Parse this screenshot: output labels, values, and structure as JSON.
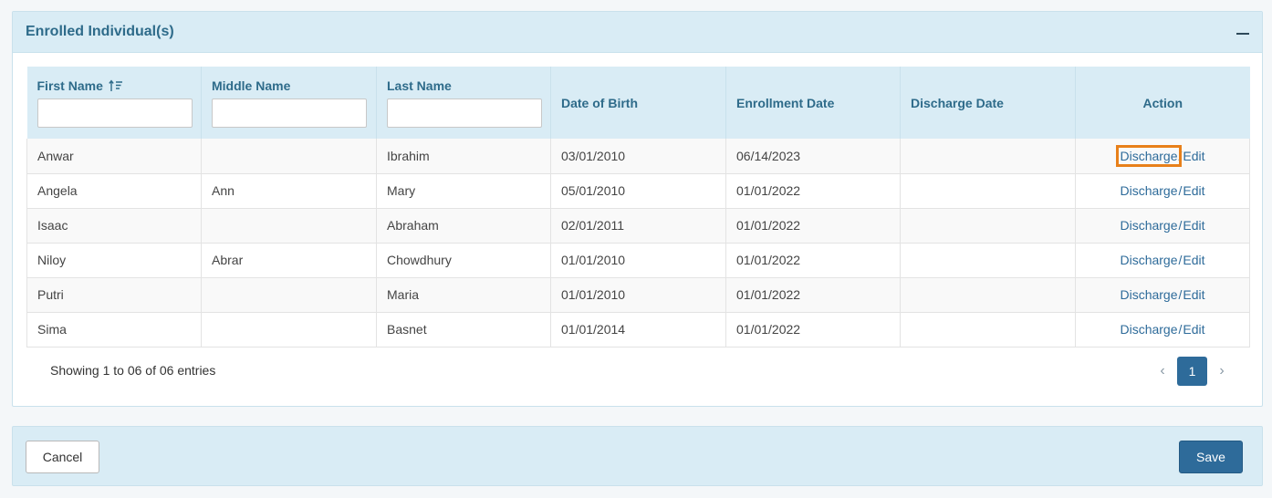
{
  "panel": {
    "title": "Enrolled Individual(s)"
  },
  "table": {
    "headers": {
      "first_name": "First Name",
      "middle_name": "Middle Name",
      "last_name": "Last Name",
      "dob": "Date of Birth",
      "enrollment_date": "Enrollment Date",
      "discharge_date": "Discharge Date",
      "action": "Action"
    },
    "rows": [
      {
        "first": "Anwar",
        "middle": "",
        "last": "Ibrahim",
        "dob": "03/01/2010",
        "enrolled": "06/14/2023",
        "discharged": "",
        "discharge": "Discharge",
        "sep": "/",
        "edit": "Edit"
      },
      {
        "first": "Angela",
        "middle": "Ann",
        "last": "Mary",
        "dob": "05/01/2010",
        "enrolled": "01/01/2022",
        "discharged": "",
        "discharge": "Discharge",
        "sep": "/",
        "edit": "Edit"
      },
      {
        "first": "Isaac",
        "middle": "",
        "last": "Abraham",
        "dob": "02/01/2011",
        "enrolled": "01/01/2022",
        "discharged": "",
        "discharge": "Discharge",
        "sep": "/",
        "edit": "Edit"
      },
      {
        "first": "Niloy",
        "middle": "Abrar",
        "last": "Chowdhury",
        "dob": "01/01/2010",
        "enrolled": "01/01/2022",
        "discharged": "",
        "discharge": "Discharge",
        "sep": "/",
        "edit": "Edit"
      },
      {
        "first": "Putri",
        "middle": "",
        "last": "Maria",
        "dob": "01/01/2010",
        "enrolled": "01/01/2022",
        "discharged": "",
        "discharge": "Discharge",
        "sep": "/",
        "edit": "Edit"
      },
      {
        "first": "Sima",
        "middle": "",
        "last": "Basnet",
        "dob": "01/01/2014",
        "enrolled": "01/01/2022",
        "discharged": "",
        "discharge": "Discharge",
        "sep": "/",
        "edit": "Edit"
      }
    ]
  },
  "footer": {
    "info": "Showing 1 to 06 of 06 entries"
  },
  "pagination": {
    "prev": "‹",
    "current": "1",
    "next": "›"
  },
  "actions": {
    "cancel": "Cancel",
    "save": "Save"
  },
  "colors": {
    "accent": "#2e6b9a",
    "header_bg": "#d9ecf5",
    "highlight": "#e8801a"
  },
  "icons": {
    "collapse": "minus-icon",
    "sort": "sort-ascending-icon"
  }
}
